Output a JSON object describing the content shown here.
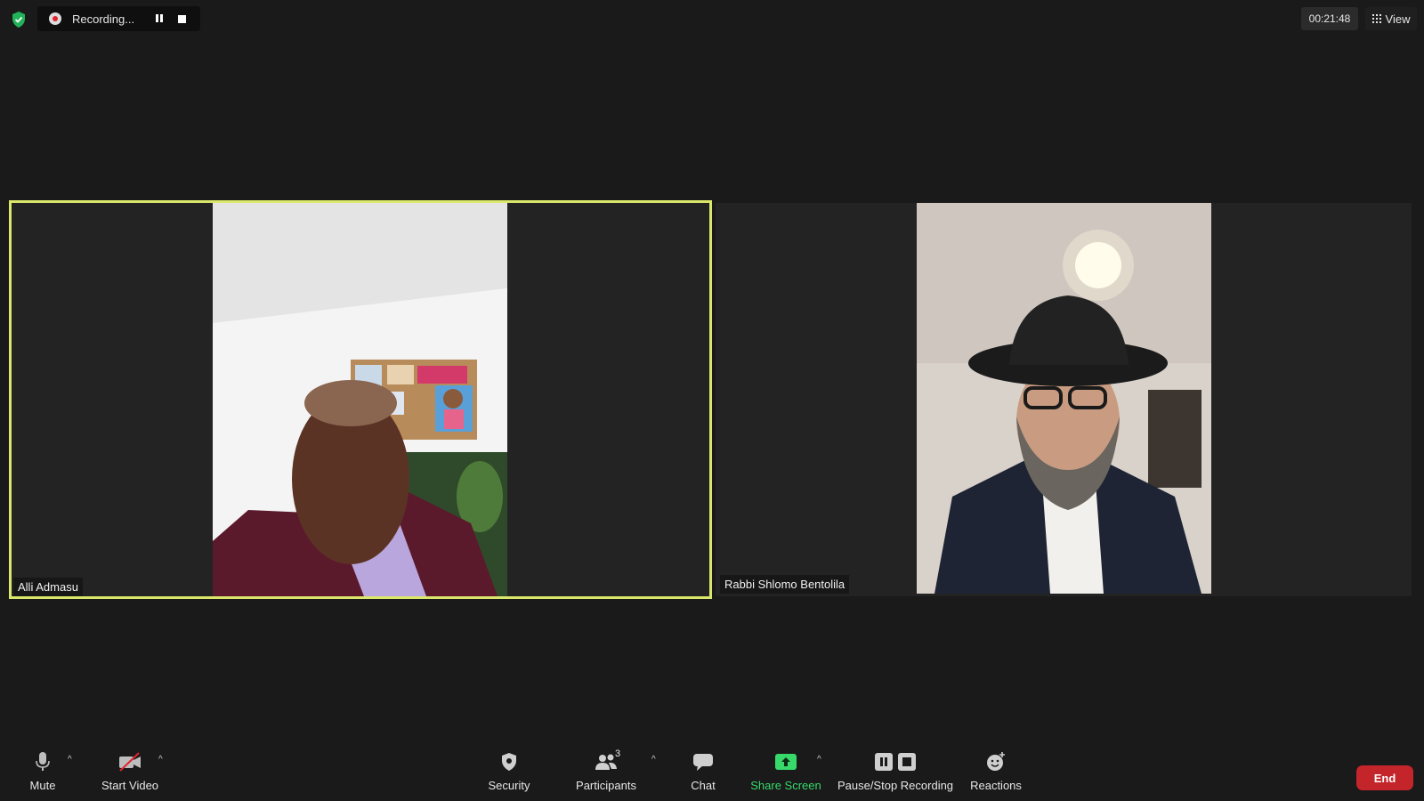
{
  "topbar": {
    "recording_label": "Recording...",
    "timer": "00:21:48",
    "view_label": "View"
  },
  "participants": [
    {
      "name": "Alli Admasu",
      "active_speaker": true
    },
    {
      "name": "Rabbi Shlomo Bentolila",
      "active_speaker": false
    }
  ],
  "toolbar": {
    "mute": "Mute",
    "start_video": "Start Video",
    "security": "Security",
    "participants": "Participants",
    "participant_count": "3",
    "chat": "Chat",
    "share_screen": "Share Screen",
    "pause_stop_recording": "Pause/Stop Recording",
    "reactions": "Reactions",
    "end": "End"
  },
  "colors": {
    "background": "#1a1a1a",
    "active_border": "#dbe76a",
    "share_green": "#36d96a",
    "end_red": "#c4252b",
    "security_shield": "#22b35a"
  },
  "icons": [
    "shield-icon",
    "record-icon",
    "pause-icon",
    "stop-icon",
    "grid-icon",
    "microphone-icon",
    "video-off-icon",
    "security-shield-icon",
    "participants-icon",
    "chat-icon",
    "share-screen-icon",
    "pause-stop-recording-icon",
    "reactions-icon",
    "chevron-up-icon"
  ]
}
